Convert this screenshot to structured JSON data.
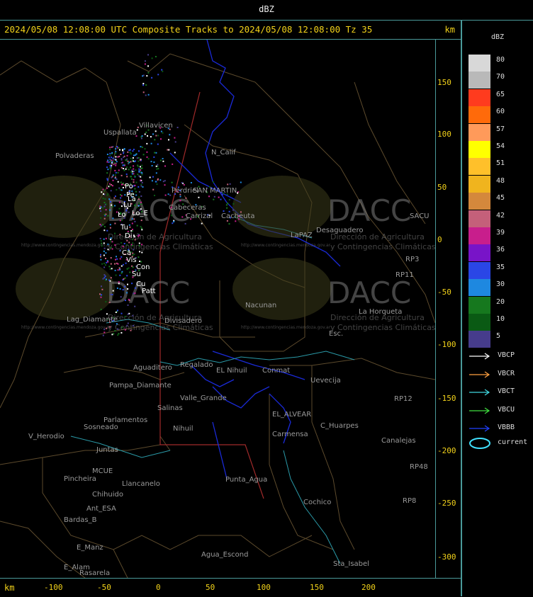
{
  "window_title": "dBZ",
  "header": {
    "title": "2024/05/08 12:08:00 UTC Composite Tracks to 2024/05/08 12:08:00 Tz 35",
    "unit": "km"
  },
  "axes": {
    "y_ticks": [
      "150",
      "100",
      "50",
      "0",
      "-50",
      "-100",
      "-150",
      "-200",
      "-250",
      "-300"
    ],
    "x_ticks": [
      "-100",
      "-50",
      "0",
      "50",
      "100",
      "150",
      "200"
    ],
    "x_unit": "km"
  },
  "legend": {
    "title": "dBZ",
    "scale": [
      {
        "value": "80",
        "color": "#d8d8d8"
      },
      {
        "value": "70",
        "color": "#b9b9b9"
      },
      {
        "value": "65",
        "color": "#ff3b1e"
      },
      {
        "value": "60",
        "color": "#ff6a0a"
      },
      {
        "value": "57",
        "color": "#ff9a5a"
      },
      {
        "value": "54",
        "color": "#ffff00"
      },
      {
        "value": "51",
        "color": "#ffc02a"
      },
      {
        "value": "48",
        "color": "#f0b41e"
      },
      {
        "value": "45",
        "color": "#d4883c"
      },
      {
        "value": "42",
        "color": "#c4607a"
      },
      {
        "value": "39",
        "color": "#c81e8c"
      },
      {
        "value": "36",
        "color": "#7814c8"
      },
      {
        "value": "35",
        "color": "#2a46e6"
      },
      {
        "value": "30",
        "color": "#1e88e0"
      },
      {
        "value": "20",
        "color": "#16781e"
      },
      {
        "value": "10",
        "color": "#0a5a14"
      },
      {
        "value": "5",
        "color": "#463c8c"
      }
    ],
    "tracks": [
      {
        "label": "VBCP",
        "color": "#ffffff"
      },
      {
        "label": "VBCR",
        "color": "#ffa040"
      },
      {
        "label": "VBCT",
        "color": "#40d8e0"
      },
      {
        "label": "VBCU",
        "color": "#40e040"
      },
      {
        "label": "VBBB",
        "color": "#2040ff"
      }
    ],
    "current_label": "current",
    "current_color": "#40e0ff"
  },
  "map": {
    "watermark_logo": "DACC",
    "watermark_line1": "Dirección de Agricultura",
    "watermark_line2": "y Contingencias Climáticas",
    "watermark_url": "http://www.contingencias.mendoza.gov.ar",
    "places": [
      "Villavicen",
      "Uspallata",
      "Polvaderas",
      "N_Calif",
      "SAN MARTIN",
      "Perdriel",
      "Cabeceras",
      "Carrizal",
      "Cacheuta",
      "LaPAZ",
      "Desaguadero",
      "SACU",
      "RP3",
      "RP11",
      "Nacunan",
      "La Horqueta",
      "Esc.",
      "Lag_Diamante",
      "Divisadero",
      "Aguaditero",
      "Regalado",
      "EL Nihuil",
      "Conmat",
      "Uevecija",
      "Pampa_Diamante",
      "Valle_Grande",
      "Salinas",
      "Parlamentos",
      "Sosneado",
      "V_Herodio",
      "Juntas",
      "Nihuil",
      "EL_ALVEAR",
      "Carmensa",
      "C_Huarpes",
      "Canalejas",
      "RP12",
      "RP48",
      "Pincheira",
      "Llancanelo",
      "Chihuido",
      "Ant_ESA",
      "Punta_Agua",
      "Cochico",
      "Bardas_B",
      "E_Manz",
      "E_Alam",
      "Rasarela",
      "Agua_Escond",
      "Sta_Isabel",
      "MCUE",
      "RP8"
    ],
    "storm_ids": [
      "Po",
      "Pe",
      "La",
      "Lu",
      "Lo",
      "Lo_E",
      "Tu",
      "Di",
      "Ca",
      "Vis",
      "Con",
      "Su",
      "Cu",
      "Patt"
    ]
  }
}
